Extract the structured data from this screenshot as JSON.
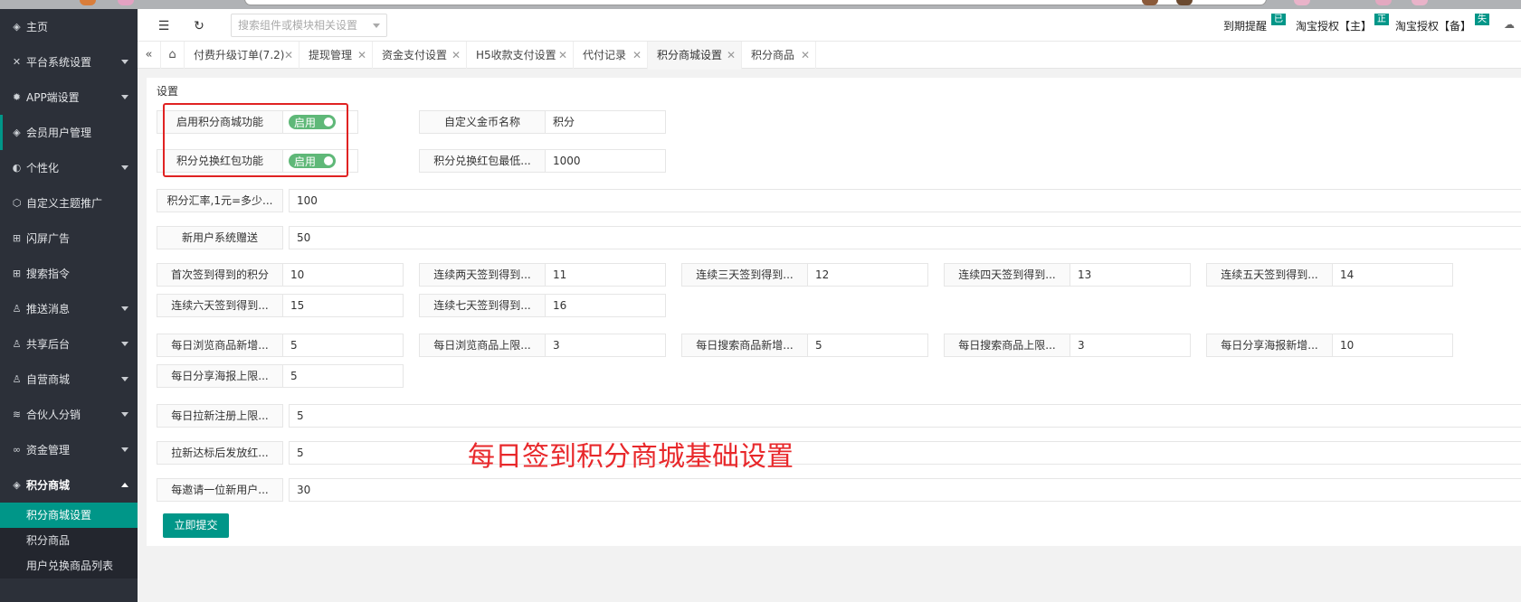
{
  "sidebar": {
    "items": [
      {
        "label": "主页",
        "icon": "shield-check-icon"
      },
      {
        "label": "平台系统设置",
        "icon": "tools-icon"
      },
      {
        "label": "APP端设置",
        "icon": "gear-icon"
      },
      {
        "label": "会员用户管理",
        "icon": "shield-check-icon"
      },
      {
        "label": "个性化",
        "icon": "palette-icon"
      },
      {
        "label": "自定义主题推广",
        "icon": "cube-icon"
      },
      {
        "label": "闪屏广告",
        "icon": "grid-icon"
      },
      {
        "label": "搜索指令",
        "icon": "grid-icon"
      },
      {
        "label": "推送消息",
        "icon": "user-icon"
      },
      {
        "label": "共享后台",
        "icon": "user-icon"
      },
      {
        "label": "自营商城",
        "icon": "user-icon"
      },
      {
        "label": "合伙人分销",
        "icon": "layers-icon"
      },
      {
        "label": "资金管理",
        "icon": "link-icon"
      },
      {
        "label": "积分商城",
        "icon": "shield-check-icon"
      }
    ],
    "sub_items": [
      {
        "label": "积分商城设置"
      },
      {
        "label": "积分商品"
      },
      {
        "label": "用户兑换商品列表"
      }
    ]
  },
  "header": {
    "search_placeholder": "搜索组件或模块相关设置",
    "expiry_label": "到期提醒",
    "badge1": "已",
    "auth_main": "淘宝授权【主】",
    "badge2": "正",
    "auth_backup": "淘宝授权【备】",
    "badge3": "失"
  },
  "tabs": [
    {
      "label": "付费升级订单(7.2)"
    },
    {
      "label": "提现管理"
    },
    {
      "label": "资金支付设置"
    },
    {
      "label": "H5收款支付设置"
    },
    {
      "label": "代付记录"
    },
    {
      "label": "积分商城设置"
    },
    {
      "label": "积分商品"
    }
  ],
  "form": {
    "panel_title": "设置",
    "enable_shop_label": "启用积分商城功能",
    "enable_shop_value": "启用",
    "coin_name_label": "自定义金币名称",
    "coin_name_value": "积分",
    "redpack_label": "积分兑换红包功能",
    "redpack_value": "启用",
    "redpack_min_label": "积分兑换红包最低...",
    "redpack_min_value": "1000",
    "rate_label": "积分汇率,1元=多少...",
    "rate_value": "100",
    "new_user_label": "新用户系统赠送",
    "new_user_value": "50",
    "sign_in": [
      {
        "label": "首次签到得到的积分",
        "value": "10"
      },
      {
        "label": "连续两天签到得到...",
        "value": "11"
      },
      {
        "label": "连续三天签到得到...",
        "value": "12"
      },
      {
        "label": "连续四天签到得到...",
        "value": "13"
      },
      {
        "label": "连续五天签到得到...",
        "value": "14"
      },
      {
        "label": "连续六天签到得到...",
        "value": "15"
      },
      {
        "label": "连续七天签到得到...",
        "value": "16"
      }
    ],
    "daily": [
      {
        "label": "每日浏览商品新增...",
        "value": "5"
      },
      {
        "label": "每日浏览商品上限...",
        "value": "3"
      },
      {
        "label": "每日搜索商品新增...",
        "value": "5"
      },
      {
        "label": "每日搜索商品上限...",
        "value": "3"
      },
      {
        "label": "每日分享海报新增...",
        "value": "10"
      },
      {
        "label": "每日分享海报上限...",
        "value": "5"
      }
    ],
    "invite_limit_label": "每日拉新注册上限...",
    "invite_limit_value": "5",
    "redpack_after_label": "拉新达标后发放红...",
    "redpack_after_value": "5",
    "per_invite_label": "每邀请一位新用户...",
    "per_invite_value": "30",
    "submit_label": "立即提交"
  },
  "annotation": "每日签到积分商城基础设置",
  "colors": {
    "sidebar_bg": "#2c3039",
    "accent": "#009688",
    "toggle_on": "#5fb878",
    "annotation": "#e8282b"
  }
}
